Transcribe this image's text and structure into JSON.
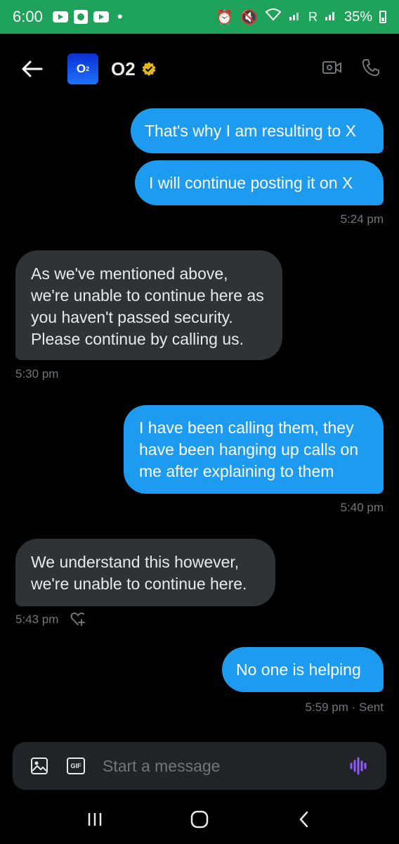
{
  "status_bar": {
    "time": "6:00",
    "signal_label": "R",
    "battery": "35%"
  },
  "header": {
    "name": "O2",
    "avatar_text": "O",
    "avatar_sub": "2"
  },
  "messages": [
    {
      "text": "That's why I am resulting to X"
    },
    {
      "text": "I will continue posting it on X"
    },
    {
      "time": "5:24 pm"
    },
    {
      "text": "As we've mentioned above, we're unable to continue here as you haven't passed security. Please continue by calling us."
    },
    {
      "time": "5:30 pm"
    },
    {
      "text": "I have been calling them, they have been hanging up calls on me after explaining to them"
    },
    {
      "time": "5:40 pm"
    },
    {
      "text": "We understand this however, we're unable to continue here."
    },
    {
      "time": "5:43 pm"
    },
    {
      "text": "No one is helping"
    },
    {
      "time": "5:59 pm · Sent"
    }
  ],
  "composer": {
    "placeholder": "Start a message",
    "gif_label": "GIF"
  },
  "colors": {
    "sent_bubble": "#1d9bf0",
    "received_bubble": "#2f3336",
    "status_bar": "#1fa25a",
    "voice_accent": "#8b5cf6"
  },
  "icons": [
    "back-arrow-icon",
    "verified-badge-icon",
    "video-call-icon",
    "phone-call-icon",
    "heart-plus-icon",
    "image-icon",
    "gif-icon",
    "voice-message-icon"
  ]
}
